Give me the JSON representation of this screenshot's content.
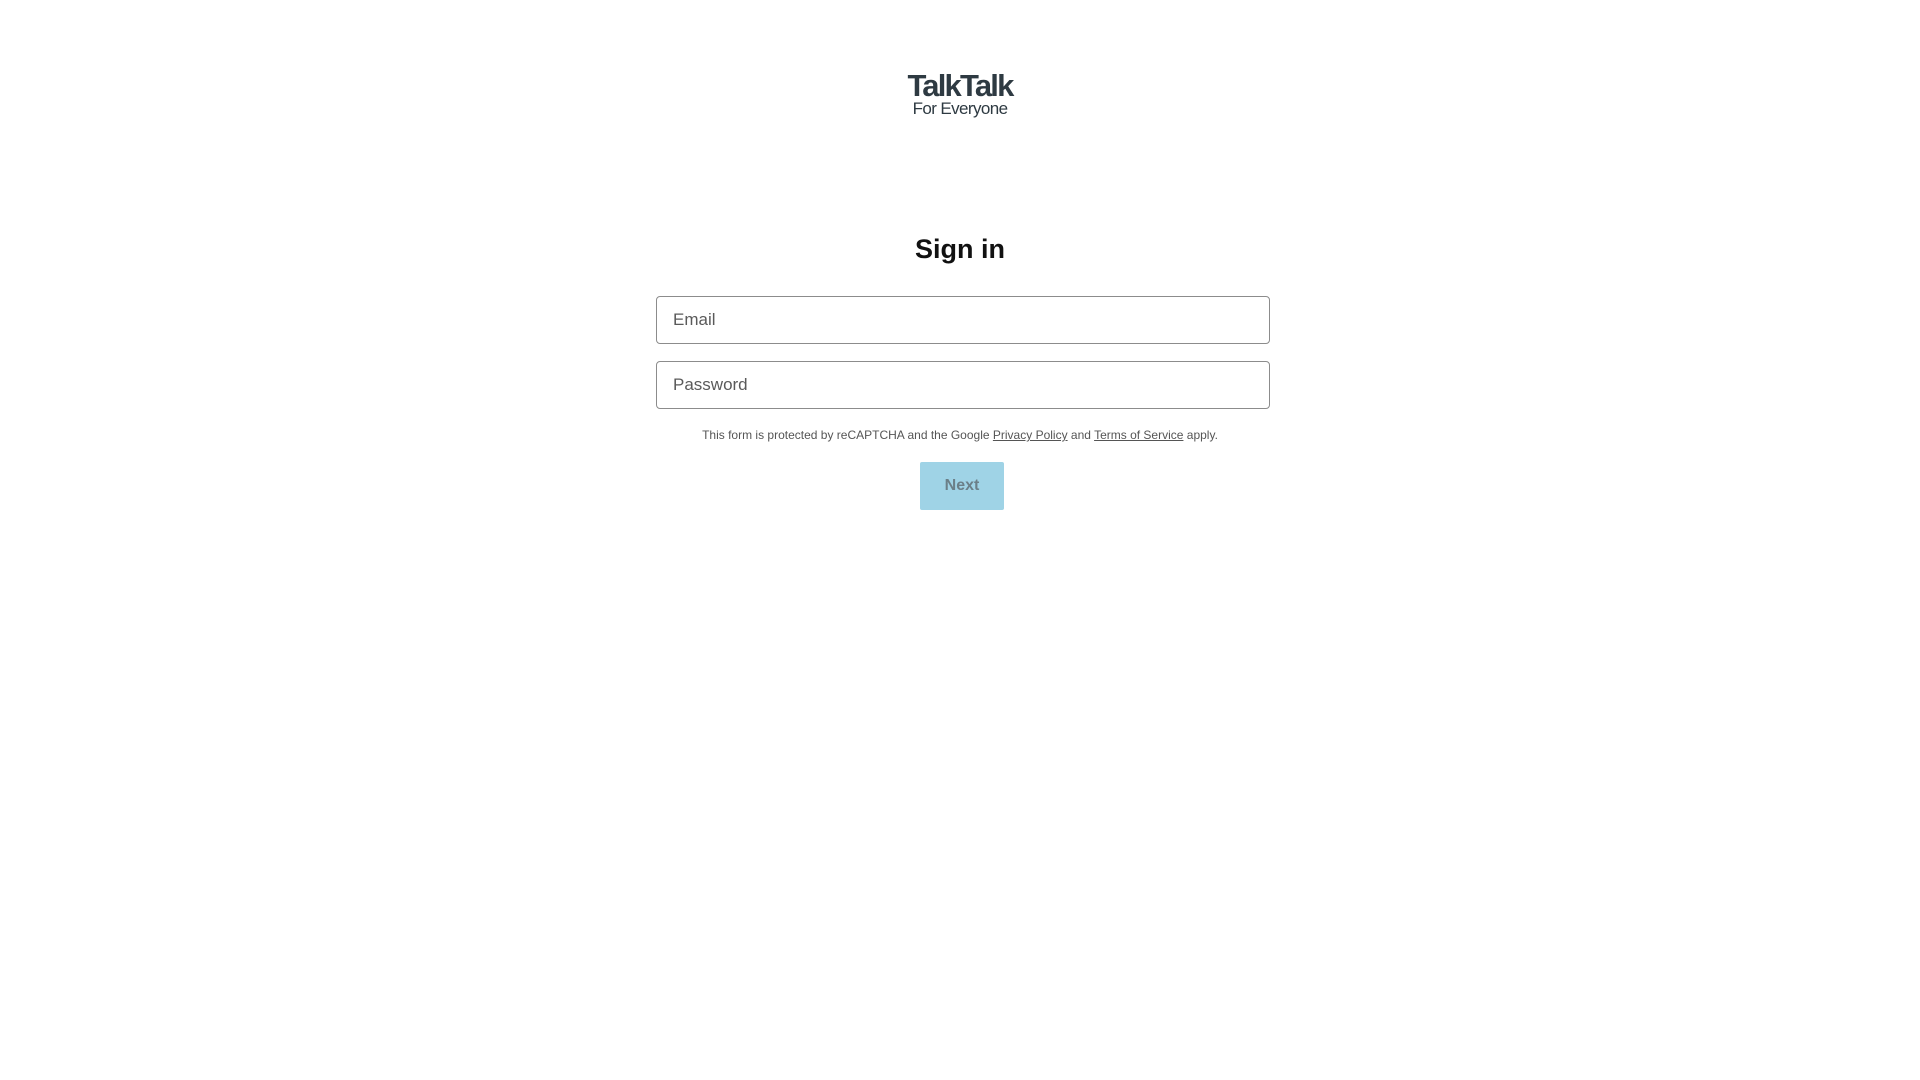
{
  "logo": {
    "brand": "TalkTalk",
    "tagline": "For Everyone"
  },
  "form": {
    "title": "Sign in",
    "email": {
      "placeholder": "Email",
      "value": ""
    },
    "password": {
      "placeholder": "Password",
      "value": ""
    },
    "legal": {
      "prefix": "This form is protected by reCAPTCHA and the Google",
      "privacy_link": "Privacy Policy",
      "conjunction": "and",
      "terms_link": "Terms of Service",
      "suffix": "apply."
    },
    "next_label": "Next"
  },
  "colors": {
    "button_bg": "#9fd3e6",
    "logo_text": "#2e3a42"
  }
}
